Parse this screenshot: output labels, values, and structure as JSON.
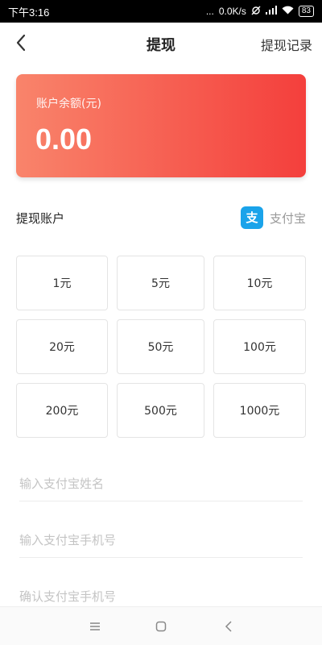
{
  "status_bar": {
    "time": "下午3:16",
    "dots": "...",
    "speed": "0.0K/s",
    "battery": "83"
  },
  "header": {
    "back_icon": "chevron-left-icon",
    "title": "提现",
    "record_label": "提现记录"
  },
  "balance": {
    "label": "账户余额(元)",
    "value": "0.00",
    "gradient_start": "#f9846b",
    "gradient_end": "#f43f3c"
  },
  "account": {
    "label": "提现账户",
    "provider_icon": "alipay-icon",
    "provider_name": "支付宝",
    "provider_color": "#1aa3ea"
  },
  "amounts": [
    "1元",
    "5元",
    "10元",
    "20元",
    "50元",
    "100元",
    "200元",
    "500元",
    "1000元"
  ],
  "form": {
    "name_placeholder": "输入支付宝姓名",
    "phone_placeholder": "输入支付宝手机号",
    "confirm_phone_placeholder": "确认支付宝手机号"
  },
  "system_nav": {
    "menu_icon": "menu-icon",
    "home_icon": "home-icon",
    "back_icon": "back-icon"
  }
}
